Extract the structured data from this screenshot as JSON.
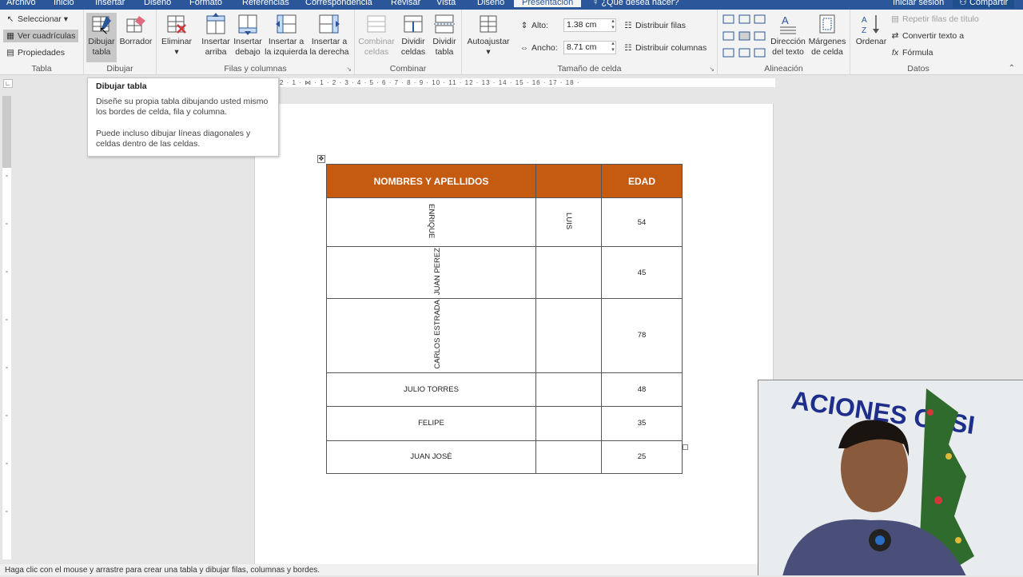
{
  "tabs": [
    {
      "label": "Archivo"
    },
    {
      "label": "Inicio"
    },
    {
      "label": "Insertar"
    },
    {
      "label": "Diseño"
    },
    {
      "label": "Formato"
    },
    {
      "label": "Referencias"
    },
    {
      "label": "Correspondencia"
    },
    {
      "label": "Revisar"
    },
    {
      "label": "Vista"
    },
    {
      "label": "Diseño"
    },
    {
      "label": "Presentación"
    }
  ],
  "tell_me": "¿Qué desea hacer?",
  "sign_in": "Iniciar sesión",
  "share": "Compartir",
  "ribbon": {
    "tabla": {
      "label": "Tabla",
      "seleccionar": "Seleccionar",
      "ver_cuadriculas": "Ver cuadrículas",
      "propiedades": "Propiedades"
    },
    "dibujar": {
      "label": "Dibujar",
      "dibujar_tabla_1": "Dibujar",
      "dibujar_tabla_2": "tabla",
      "borrador": "Borrador"
    },
    "filas_columnas": {
      "label": "Filas y columnas",
      "eliminar": "Eliminar",
      "insertar_arriba_1": "Insertar",
      "insertar_arriba_2": "arriba",
      "insertar_debajo_1": "Insertar",
      "insertar_debajo_2": "debajo",
      "insertar_izq_1": "Insertar a",
      "insertar_izq_2": "la izquierda",
      "insertar_der_1": "Insertar a",
      "insertar_der_2": "la derecha"
    },
    "combinar": {
      "label": "Combinar",
      "combinar_1": "Combinar",
      "combinar_2": "celdas",
      "dividir_celdas_1": "Dividir",
      "dividir_celdas_2": "celdas",
      "dividir_tabla_1": "Dividir",
      "dividir_tabla_2": "tabla"
    },
    "tamano": {
      "label": "Tamaño de celda",
      "autoajustar": "Autoajustar",
      "alto_label": "Alto:",
      "alto_value": "1.38 cm",
      "ancho_label": "Ancho:",
      "ancho_value": "8.71 cm",
      "distribuir_filas": "Distribuir filas",
      "distribuir_columnas": "Distribuir columnas"
    },
    "alineacion": {
      "label": "Alineación",
      "direccion_1": "Dirección",
      "direccion_2": "del texto",
      "margenes_1": "Márgenes",
      "margenes_2": "de celda"
    },
    "datos": {
      "label": "Datos",
      "ordenar": "Ordenar",
      "repetir": "Repetir filas de título",
      "convertir": "Convertir texto a",
      "formula": "Fórmula"
    }
  },
  "tooltip": {
    "title": "Dibujar tabla",
    "line1": "Diseñe su propia tabla dibujando usted mismo los bordes de celda, fila y columna.",
    "line2": "Puede incluso dibujar líneas diagonales y celdas dentro de las celdas."
  },
  "ruler_text": "2 · 1 · ⋈ · 1 · 2 · 3 · 4 · 5 · 6 · 7 · 8 · 9 · 10 · 11 · 12 · 13 · 14 · 15 · 16 · 17 · 18 ·",
  "table": {
    "headers": [
      "NOMBRES Y APELLIDOS",
      "",
      "EDAD"
    ],
    "rows": [
      {
        "name": "ENRIQUE",
        "middle": "LUIS",
        "age": "54"
      },
      {
        "name": "JUAN PEREZ",
        "middle": "",
        "age": "45"
      },
      {
        "name": "CARLOS ESTRADA",
        "middle": "",
        "age": "78"
      },
      {
        "name": "JULIO TORRES",
        "middle": "",
        "age": "48"
      },
      {
        "name": "FELIPE",
        "middle": "",
        "age": "35"
      },
      {
        "name": "JUAN JOSÉ",
        "middle": "",
        "age": "25"
      }
    ]
  },
  "status": "Haga clic con el mouse y arrastre para crear una tabla y dibujar filas, columnas y bordes.",
  "webcam_sign": "ACIONES CASI",
  "colors": {
    "accent": "#2b579a",
    "header_fill": "#c55a11"
  }
}
